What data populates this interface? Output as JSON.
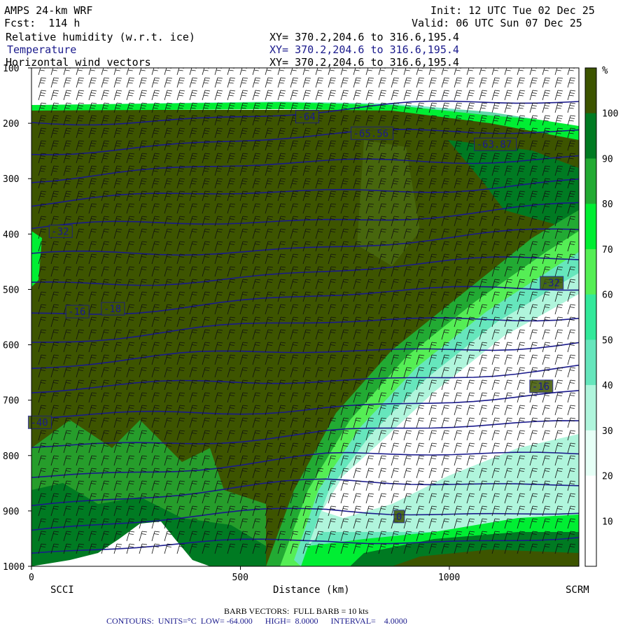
{
  "header": {
    "model": "AMPS 24-km WRF",
    "forecast": "Fcst:  114 h",
    "init": "Init: 12 UTC Tue 02 Dec 25",
    "valid": "Valid: 06 UTC Sun 07 Dec 25",
    "fields": [
      {
        "name": "Relative humidity (w.r.t. ice)",
        "xy": "XY= 370.2,204.6 to 316.6,195.4",
        "color": "#000000"
      },
      {
        "name": "Temperature",
        "xy": "XY= 370.2,204.6 to 316.6,195.4",
        "color": "#1a1a8c"
      },
      {
        "name": "Horizontal wind vectors",
        "xy": "XY= 370.2,204.6 to 316.6,195.4",
        "color": "#000000"
      }
    ]
  },
  "footer": {
    "barb_note": "BARB VECTORS:  FULL BARB = 10 kts",
    "contour_note": "CONTOURS:  UNITS=°C  LOW= -64.000      HIGH=  8.0000      INTERVAL=    4.0000"
  },
  "chart_data": {
    "type": "heatmap",
    "title": "Relative humidity (w.r.t. ice)",
    "xlabel": "Distance (km)",
    "ylabel": "",
    "xlim": [
      0,
      1310
    ],
    "ylim": [
      1000,
      100
    ],
    "x_ticks": [
      0,
      500,
      1000
    ],
    "y_ticks": [
      100,
      200,
      300,
      400,
      500,
      600,
      700,
      800,
      900,
      1000
    ],
    "endpoints": {
      "left": "SCCI",
      "right": "SCRM"
    },
    "colorbar": {
      "unit": "%",
      "levels": [
        10,
        20,
        30,
        40,
        50,
        60,
        70,
        80,
        90,
        100
      ],
      "colors": [
        "#ffffff",
        "#ffffff",
        "#e6fff6",
        "#b0f5dc",
        "#66e6bc",
        "#33e89a",
        "#55ee55",
        "#00ee33",
        "#22aa33",
        "#007a22",
        "#3d5400"
      ]
    },
    "temperature_labels": [
      {
        "value": "-64",
        "x_km": 660,
        "p": 188
      },
      {
        "value": "-65.56",
        "x_km": 815,
        "p": 218
      },
      {
        "value": "-63.87",
        "x_km": 1110,
        "p": 238
      },
      {
        "value": "-32",
        "x_km": 70,
        "p": 395
      },
      {
        "value": "-32",
        "x_km": 1245,
        "p": 488
      },
      {
        "value": "-16",
        "x_km": 110,
        "p": 540
      },
      {
        "value": "-18",
        "x_km": 195,
        "p": 535
      },
      {
        "value": "-16",
        "x_km": 1220,
        "p": 675
      },
      {
        "value": "-40",
        "x_km": 20,
        "p": 740
      },
      {
        "value": "0",
        "x_km": 880,
        "p": 910
      }
    ],
    "isotherm_levels": [
      -64,
      -60,
      -56,
      -52,
      -48,
      -44,
      -40,
      -36,
      -32,
      -28,
      -24,
      -20,
      -16,
      -12,
      -8,
      -4,
      0
    ],
    "dry_region": "white/teal low humidity wedge from ~900 hPa at 500 km rising to ~400 hPa at 1300 km",
    "terrain": {
      "peak_x_km": 230,
      "peak_p": 930
    }
  }
}
